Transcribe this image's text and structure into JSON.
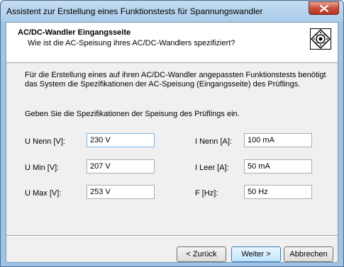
{
  "window": {
    "title": "Assistent zur Erstellung eines Funktionstests für Spannungswandler"
  },
  "header": {
    "title": "AC/DC-Wandler Eingangsseite",
    "subtitle": "Wie ist die AC-Speisung ihres AC/DC-Wandlers spezifiziert?",
    "icon": "wizard-gear-icon"
  },
  "body": {
    "intro_line1": "Für die Erstellung eines auf ihren AC/DC-Wandler angepassten Funktionstests benötigt",
    "intro_line2": "das System die Spezifikationen der AC-Speisung (Eingangsseite) des Prüflings.",
    "prompt": "Geben Sie die Spezifikationen der Speisung des Prüflings ein."
  },
  "fields": {
    "u_nenn": {
      "label": "U Nenn [V]:",
      "value": "230 V"
    },
    "u_min": {
      "label": "U Min [V]:",
      "value": "207 V"
    },
    "u_max": {
      "label": "U Max [V]:",
      "value": "253 V"
    },
    "i_nenn": {
      "label": "I Nenn [A]:",
      "value": "100 mA"
    },
    "i_leer": {
      "label": "I Leer [A]:",
      "value": "50 mA"
    },
    "f": {
      "label": "F [Hz]:",
      "value": "50 Hz"
    }
  },
  "buttons": {
    "back": "< Zurück",
    "next": "Weiter >",
    "cancel": "Abbrechen"
  },
  "colors": {
    "frame": "#9ec4e6",
    "close_button": "#c9503b",
    "client_bg": "#f0f0f0",
    "focus_border": "#7eb4ea"
  }
}
